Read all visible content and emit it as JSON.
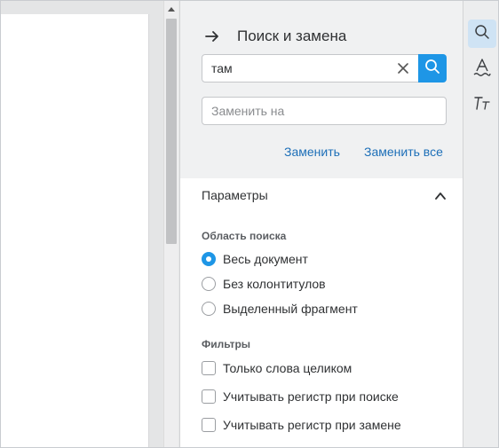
{
  "panel": {
    "title": "Поиск и замена",
    "search": {
      "value": "там"
    },
    "replace": {
      "placeholder": "Заменить на"
    },
    "actions": {
      "replace": "Заменить",
      "replace_all": "Заменить все"
    },
    "params": {
      "label": "Параметры",
      "scope": {
        "title": "Область поиска",
        "options": [
          "Весь документ",
          "Без колонтитулов",
          "Выделенный фрагмент"
        ],
        "selected": 0
      },
      "filters": {
        "title": "Фильтры",
        "options": [
          "Только слова целиком",
          "Учитывать регистр при поиске",
          "Учитывать регистр при замене"
        ]
      }
    }
  },
  "toolbar": {
    "tools": [
      "search-icon",
      "text-style-icon",
      "font-size-icon"
    ],
    "active": "search-icon"
  },
  "colors": {
    "accent": "#1e96e6",
    "link": "#1d6fb8"
  }
}
